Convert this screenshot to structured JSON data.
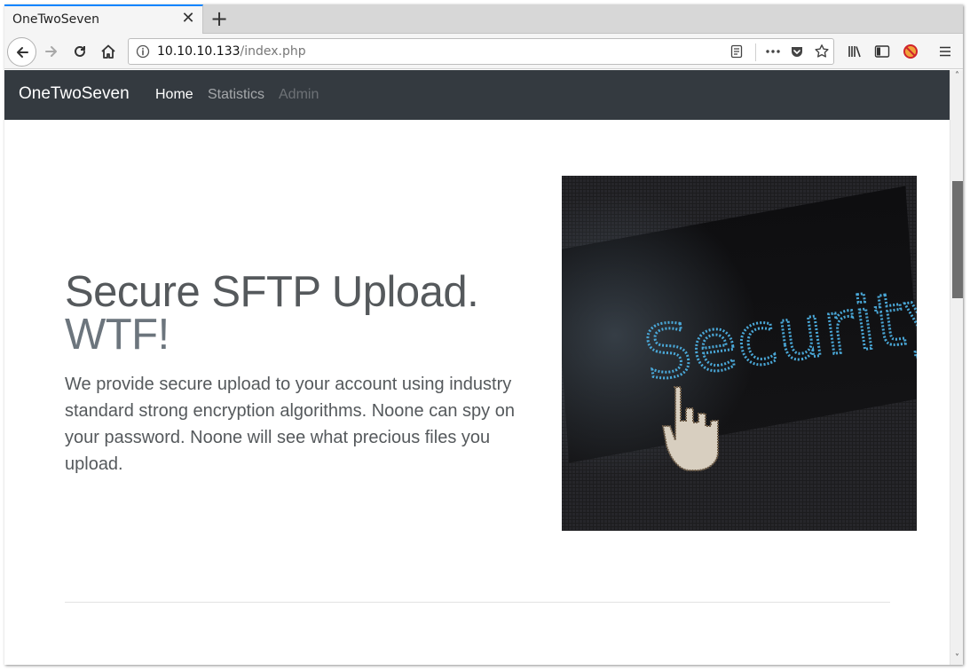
{
  "browser": {
    "tab_title": "OneTwoSeven",
    "url_host": "10.10.10.133",
    "url_path": "/index.php",
    "icons": [
      "back-icon",
      "forward-icon",
      "reload-icon",
      "home-icon",
      "info-icon",
      "reader-view-icon",
      "more-actions-icon",
      "pocket-icon",
      "bookmark-star-icon",
      "library-icon",
      "sidebar-icon",
      "blocked-extension-icon",
      "menu-icon"
    ]
  },
  "site": {
    "brand": "OneTwoSeven",
    "nav": [
      {
        "label": "Home",
        "state": "active"
      },
      {
        "label": "Statistics",
        "state": "normal"
      },
      {
        "label": "Admin",
        "state": "disabled"
      }
    ],
    "hero": {
      "title_line1": "Secure SFTP Upload.",
      "title_line2": "WTF!",
      "text": "We provide secure upload to your account using industry standard strong encryption algorithms. Noone can spy on your password. Noone will see what precious files you upload.",
      "image_word": "Security"
    }
  },
  "colors": {
    "navbar_bg": "#343a40",
    "tab_accent": "#0a84ff",
    "image_text": "#4aa8d8"
  }
}
